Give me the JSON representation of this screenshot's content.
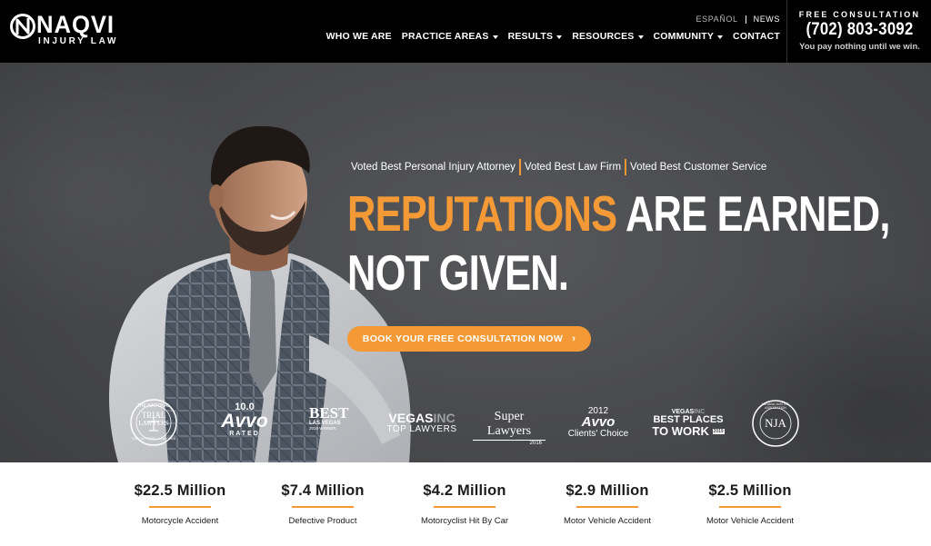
{
  "brand": {
    "name": "NAQVI",
    "sub": "INJURY LAW"
  },
  "utility_nav": [
    {
      "label": "ESPAÑOL"
    },
    {
      "label": "NEWS"
    }
  ],
  "main_nav": [
    {
      "label": "WHO WE ARE",
      "dropdown": false
    },
    {
      "label": "PRACTICE AREAS",
      "dropdown": true
    },
    {
      "label": "RESULTS",
      "dropdown": true
    },
    {
      "label": "RESOURCES",
      "dropdown": true
    },
    {
      "label": "COMMUNITY",
      "dropdown": true
    },
    {
      "label": "CONTACT",
      "dropdown": false
    }
  ],
  "consultation": {
    "label": "FREE CONSULTATION",
    "phone": "(702) 803-3092",
    "note": "You pay nothing until we win."
  },
  "hero": {
    "accolades": [
      "Voted Best Personal Injury Attorney",
      "Voted Best Law Firm",
      "Voted Best Customer Service"
    ],
    "headline_accent": "REPUTATIONS",
    "headline_rest": "ARE EARNED,",
    "headline_line2": "NOT GIVEN.",
    "cta_label": "BOOK YOUR FREE CONSULTATION NOW",
    "cta_icon": "chevron-right-icon"
  },
  "badges": {
    "trial_lawyers": {
      "line1": "THE NATIONAL",
      "line2": "TRIAL",
      "line3": "LAWYERS",
      "line4": "TOP 100 TRIAL LAWYERS"
    },
    "avvo_rated": {
      "score": "10.0",
      "brand": "Avvo",
      "sub": "RATED"
    },
    "best_las_vegas": {
      "line1": "BEST",
      "line2": "LAS VEGAS",
      "line3": "2019 WINNER"
    },
    "vegas_inc": {
      "brand": "VEGAS",
      "brand2": "INC",
      "sub": "TOP LAWYERS"
    },
    "super_lawyers": {
      "brand": "Super Lawyers",
      "year": "2016"
    },
    "avvo_clients": {
      "year": "2012",
      "brand": "Avvo",
      "sub": "Clients' Choice"
    },
    "best_places": {
      "brand": "VEGAS",
      "brand2": "INC",
      "line1": "BEST PLACES",
      "line2": "TO WORK",
      "year": "2019"
    },
    "nja": {
      "ring": "NEVADA JUSTICE ASSOCIATION",
      "mark": "NJA"
    }
  },
  "results": [
    {
      "amount": "$22.5 Million",
      "case": "Motorcycle Accident"
    },
    {
      "amount": "$7.4 Million",
      "case": "Defective Product"
    },
    {
      "amount": "$4.2 Million",
      "case": "Motorcyclist Hit By Car"
    },
    {
      "amount": "$2.9 Million",
      "case": "Motor Vehicle Accident"
    },
    {
      "amount": "$2.5 Million",
      "case": "Motor Vehicle Accident"
    }
  ],
  "colors": {
    "accent": "#f39a36",
    "header_bg": "#000000",
    "hero_bg": "#47484b"
  }
}
